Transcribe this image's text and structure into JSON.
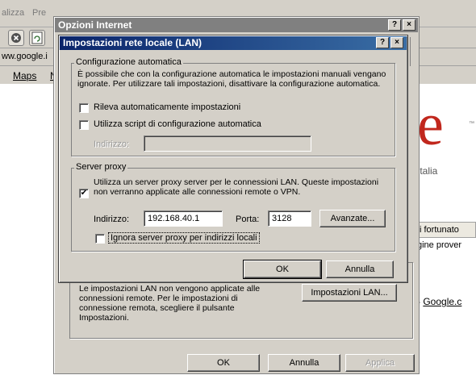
{
  "browser": {
    "menu": [
      "alizza",
      "Pre"
    ],
    "address": "ww.google.i",
    "links": [
      "Maps",
      "N"
    ],
    "google_letters": [
      "l",
      "e"
    ],
    "region": "Italia",
    "lucky_button": "i fortunato",
    "pages_from": "gine prover",
    "google_link_prefix": "-",
    "google_link": "Google.c",
    "colors": {
      "google_l": "#2f8f2f",
      "google_e": "#c1271d"
    }
  },
  "internet_options": {
    "title": "Opzioni Internet",
    "title_help": "?",
    "title_close": "×",
    "lan_description": "Le impostazioni LAN non vengono applicate alle connessioni remote. Per le impostazioni di connessione remota, scegliere il pulsante Impostazioni.",
    "lan_button": "Impostazioni LAN...",
    "ok": "OK",
    "cancel": "Annulla",
    "apply": "Applica"
  },
  "lan_dialog": {
    "title": "Impostazioni rete locale (LAN)",
    "title_help": "?",
    "title_close": "×",
    "auto_config": {
      "legend": "Configurazione automatica",
      "description": "È possibile che con la configurazione automatica le impostazioni manuali vengano ignorate. Per utilizzare tali impostazioni, disattivare la configurazione automatica.",
      "detect_label": "Rileva automaticamente impostazioni",
      "detect_checked": false,
      "script_label": "Utilizza script di configurazione automatica",
      "script_checked": false,
      "address_label": "Indirizzo:",
      "address_value": ""
    },
    "proxy": {
      "legend": "Server proxy",
      "use_proxy_label": "Utilizza un server proxy server per le connessioni LAN. Queste impostazioni non verranno applicate alle connessioni remote o VPN.",
      "use_proxy_checked": true,
      "check_mark": "✔",
      "address_label": "Indirizzo:",
      "address_value": "192.168.40.1",
      "port_label": "Porta:",
      "port_value": "3128",
      "advanced_button": "Avanzate...",
      "bypass_label": "Ignora server proxy per indirizzi locali",
      "bypass_checked": false
    },
    "ok": "OK",
    "cancel": "Annulla"
  }
}
